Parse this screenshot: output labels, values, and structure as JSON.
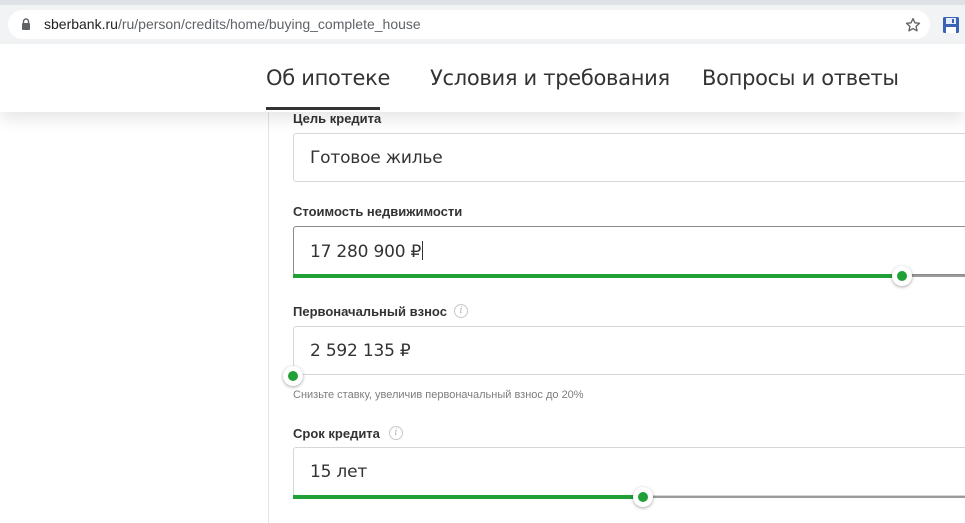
{
  "browser": {
    "url_host": "sberbank.ru",
    "url_path": "/ru/person/credits/home/buying_complete_house"
  },
  "tabs": [
    {
      "label": "Об ипотеке",
      "active": true
    },
    {
      "label": "Условия и требования",
      "active": false
    },
    {
      "label": "Вопросы и ответы",
      "active": false
    }
  ],
  "form": {
    "purpose": {
      "label": "Цель кредита",
      "value": "Готовое жилье"
    },
    "price": {
      "label": "Стоимость недвижимости",
      "value": "17 280 900 ₽",
      "slider_fraction": 0.906
    },
    "down_payment": {
      "label": "Первоначальный взнос",
      "value": "2 592 135 ₽",
      "slider_fraction": 0.0,
      "hint": "Снизьте ставку, увеличив первоначальный взнос до 20%"
    },
    "term": {
      "label": "Срок кредита",
      "value": "15 лет",
      "slider_fraction": 0.521
    }
  },
  "colors": {
    "accent": "#21a038"
  },
  "icons": [
    "lock-icon",
    "star-icon",
    "save-icon",
    "info-icon"
  ]
}
